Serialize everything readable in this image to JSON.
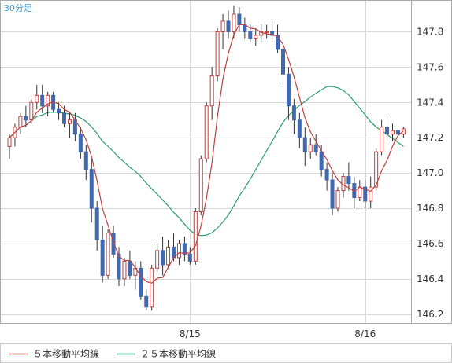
{
  "chart_data": {
    "type": "candlestick",
    "period_label": "30分足",
    "x_ticks": [
      "8/15",
      "8/16"
    ],
    "y_ticks": [
      147.8,
      147.6,
      147.4,
      147.2,
      147.0,
      146.8,
      146.6,
      146.4,
      146.2
    ],
    "ylim": [
      146.15,
      147.98
    ],
    "grid": true,
    "colors": {
      "up": "#ffffff",
      "down": "#4169b0",
      "wick": "#333333",
      "ma5": "#c04040",
      "ma25": "#2e9e6e",
      "grid": "#d8d8d8",
      "axis": "#aaaaaa"
    },
    "legend": [
      {
        "name": "５本移動平均線",
        "color": "#c04040"
      },
      {
        "name": "２５本移動平均線",
        "color": "#2e9e6e"
      }
    ],
    "candles": [
      [
        147.15,
        147.22,
        147.08,
        147.2
      ],
      [
        147.2,
        147.28,
        147.15,
        147.26
      ],
      [
        147.26,
        147.34,
        147.22,
        147.32
      ],
      [
        147.32,
        147.38,
        147.26,
        147.3
      ],
      [
        147.3,
        147.42,
        147.28,
        147.4
      ],
      [
        147.4,
        147.5,
        147.36,
        147.44
      ],
      [
        147.44,
        147.5,
        147.34,
        147.38
      ],
      [
        147.38,
        147.46,
        147.32,
        147.44
      ],
      [
        147.44,
        147.46,
        147.34,
        147.36
      ],
      [
        147.36,
        147.4,
        147.3,
        147.34
      ],
      [
        147.34,
        147.38,
        147.26,
        147.28
      ],
      [
        147.28,
        147.34,
        147.2,
        147.3
      ],
      [
        147.3,
        147.34,
        147.18,
        147.22
      ],
      [
        147.22,
        147.26,
        147.08,
        147.12
      ],
      [
        147.12,
        147.16,
        146.96,
        147.02
      ],
      [
        147.02,
        147.08,
        146.72,
        146.8
      ],
      [
        146.8,
        146.84,
        146.56,
        146.62
      ],
      [
        146.62,
        146.7,
        146.38,
        146.42
      ],
      [
        146.42,
        146.68,
        146.4,
        146.66
      ],
      [
        146.66,
        146.7,
        146.52,
        146.54
      ],
      [
        146.54,
        146.58,
        146.36,
        146.4
      ],
      [
        146.4,
        146.52,
        146.36,
        146.5
      ],
      [
        146.5,
        146.56,
        146.4,
        146.42
      ],
      [
        146.42,
        146.5,
        146.34,
        146.46
      ],
      [
        146.46,
        146.5,
        146.28,
        146.3
      ],
      [
        146.3,
        146.34,
        146.22,
        146.24
      ],
      [
        146.24,
        146.48,
        146.22,
        146.46
      ],
      [
        146.46,
        146.6,
        146.44,
        146.56
      ],
      [
        146.56,
        146.64,
        146.42,
        146.48
      ],
      [
        146.48,
        146.62,
        146.46,
        146.58
      ],
      [
        146.58,
        146.66,
        146.5,
        146.52
      ],
      [
        146.52,
        146.62,
        146.48,
        146.6
      ],
      [
        146.6,
        146.64,
        146.5,
        146.54
      ],
      [
        146.54,
        146.58,
        146.48,
        146.5
      ],
      [
        146.5,
        146.8,
        146.48,
        146.78
      ],
      [
        146.78,
        147.1,
        146.76,
        147.08
      ],
      [
        147.08,
        147.4,
        147.06,
        147.38
      ],
      [
        147.38,
        147.6,
        147.3,
        147.55
      ],
      [
        147.55,
        147.82,
        147.52,
        147.8
      ],
      [
        147.8,
        147.9,
        147.7,
        147.86
      ],
      [
        147.86,
        147.92,
        147.76,
        147.8
      ],
      [
        147.8,
        147.95,
        147.76,
        147.9
      ],
      [
        147.9,
        147.94,
        147.8,
        147.84
      ],
      [
        147.84,
        147.88,
        147.76,
        147.8
      ],
      [
        147.8,
        147.84,
        147.74,
        147.76
      ],
      [
        147.76,
        147.82,
        147.72,
        147.78
      ],
      [
        147.78,
        147.84,
        147.74,
        147.8
      ],
      [
        147.8,
        147.84,
        147.76,
        147.8
      ],
      [
        147.8,
        147.86,
        147.74,
        147.78
      ],
      [
        147.78,
        147.84,
        147.68,
        147.7
      ],
      [
        147.7,
        147.74,
        147.5,
        147.56
      ],
      [
        147.56,
        147.6,
        147.3,
        147.38
      ],
      [
        147.38,
        147.42,
        147.22,
        147.3
      ],
      [
        147.3,
        147.34,
        147.14,
        147.2
      ],
      [
        147.2,
        147.26,
        147.04,
        147.12
      ],
      [
        147.12,
        147.2,
        147.08,
        147.16
      ],
      [
        147.16,
        147.22,
        147.1,
        147.12
      ],
      [
        147.12,
        147.16,
        146.98,
        147.02
      ],
      [
        147.02,
        147.06,
        146.9,
        146.96
      ],
      [
        146.96,
        147.0,
        146.76,
        146.8
      ],
      [
        146.8,
        146.92,
        146.78,
        146.9
      ],
      [
        146.9,
        147.0,
        146.86,
        146.98
      ],
      [
        146.98,
        147.06,
        146.9,
        146.94
      ],
      [
        146.94,
        146.98,
        146.8,
        146.86
      ],
      [
        146.86,
        146.96,
        146.84,
        146.92
      ],
      [
        146.92,
        146.96,
        146.8,
        146.84
      ],
      [
        146.84,
        146.98,
        146.8,
        146.92
      ],
      [
        146.92,
        147.14,
        146.9,
        147.12
      ],
      [
        147.12,
        147.3,
        147.1,
        147.26
      ],
      [
        147.26,
        147.32,
        147.18,
        147.22
      ],
      [
        147.22,
        147.28,
        147.18,
        147.24
      ],
      [
        147.24,
        147.26,
        147.18,
        147.22
      ],
      [
        147.22,
        147.26,
        147.2,
        147.25
      ]
    ]
  }
}
